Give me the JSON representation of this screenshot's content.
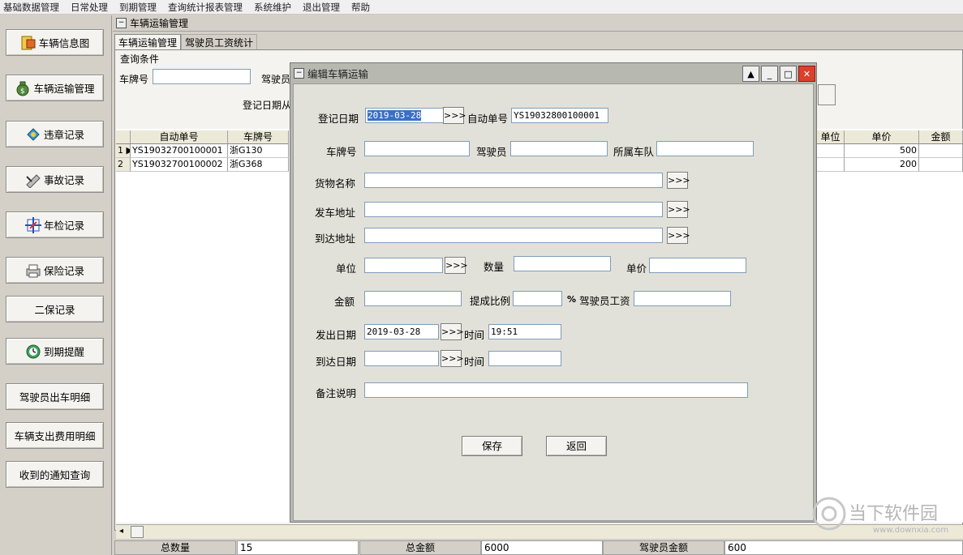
{
  "menu": [
    "基础数据管理",
    "日常处理",
    "到期管理",
    "查询统计报表管理",
    "系统维护",
    "退出管理",
    "帮助"
  ],
  "sidebar": [
    {
      "label": "车辆信息图",
      "icon": "vehicle-info-icon"
    },
    {
      "label": "车辆运输管理",
      "icon": "money-bag-icon"
    },
    {
      "label": "违章记录",
      "icon": "violation-icon"
    },
    {
      "label": "事故记录",
      "icon": "accident-icon"
    },
    {
      "label": "年检记录",
      "icon": "inspection-icon"
    },
    {
      "label": "保险记录",
      "icon": "printer-icon"
    },
    {
      "label": "二保记录"
    },
    {
      "label": "到期提醒",
      "icon": "clock-icon"
    },
    {
      "label": "驾驶员出车明细"
    },
    {
      "label": "车辆支出费用明细"
    },
    {
      "label": "收到的通知查询"
    }
  ],
  "main": {
    "window_title": "车辆运输管理",
    "tabs": [
      "车辆运输管理",
      "驾驶员工资统计"
    ],
    "query_group": "查询条件",
    "plate_label": "车牌号",
    "driver_label": "驾驶员",
    "date_from_label": "登记日期从"
  },
  "grid": {
    "columns": [
      "自动单号",
      "车牌号",
      "单位",
      "单价",
      "金额"
    ],
    "rows": [
      {
        "num": "1",
        "id": "YS19032700100001",
        "plate": "浙G130",
        "price": "500"
      },
      {
        "num": "2",
        "id": "YS19032700100002",
        "plate": "浙G368",
        "price": "200"
      }
    ]
  },
  "status": {
    "total_qty_label": "总数量",
    "total_qty": "15",
    "total_amount_label": "总金额",
    "total_amount": "6000",
    "driver_amount_label": "驾驶员金额",
    "driver_amount": "600"
  },
  "dialog": {
    "title": "编辑车辆运输",
    "reg_date_label": "登记日期",
    "reg_date": "2019-03-28",
    "auto_no_label": "自动单号",
    "auto_no": "YS19032800100001",
    "plate_label": "车牌号",
    "driver_label": "驾驶员",
    "team_label": "所属车队",
    "goods_label": "货物名称",
    "depart_addr_label": "发车地址",
    "arrive_addr_label": "到达地址",
    "unit_label": "单位",
    "qty_label": "数量",
    "price_label": "单价",
    "amount_label": "金额",
    "ratio_label": "提成比例",
    "percent": "%",
    "wage_label": "驾驶员工资",
    "depart_date_label": "发出日期",
    "depart_date": "2019-03-28",
    "time_label": "时间",
    "depart_time": "19:51",
    "arrive_date_label": "到达日期",
    "remark_label": "备注说明",
    "picker": ">>>",
    "save": "保存",
    "back": "返回"
  },
  "watermark": {
    "title": "当下软件园",
    "url": "www.downxia.com"
  }
}
